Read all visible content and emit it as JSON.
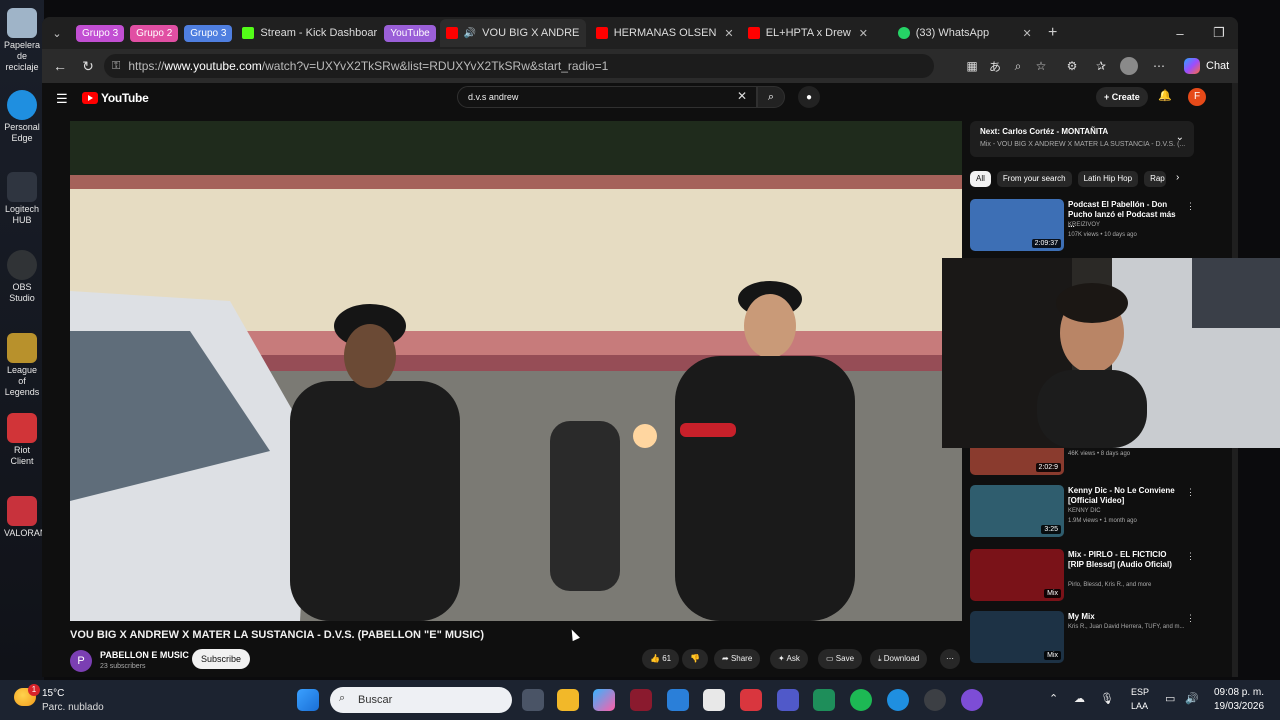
{
  "desktop": {
    "icons": [
      {
        "label": "Papelera de reciclaje",
        "color": "#9fb4c8"
      },
      {
        "label": "Personal Edge",
        "color": "#1f8fe0"
      },
      {
        "label": "Logitech HUB",
        "color": "#2f3540"
      },
      {
        "label": "OBS Studio",
        "color": "#303336"
      },
      {
        "label": "League of Legends",
        "color": "#b8912c"
      },
      {
        "label": "Riot Client",
        "color": "#d13438"
      },
      {
        "label": "VALORANT",
        "color": "#c8323c"
      }
    ]
  },
  "browser": {
    "tab_groups": [
      {
        "label": "Grupo 3",
        "color": "#c24fd3"
      },
      {
        "label": "Grupo 2",
        "color": "#e14fa3"
      },
      {
        "label": "Grupo 3",
        "color": "#4f7fe0"
      }
    ],
    "tabs": [
      {
        "title": "Stream - Kick Dashboar",
        "fav": "#53fc18",
        "active": false
      },
      {
        "group": "YouTube",
        "group_color": "#9a5fd8"
      },
      {
        "title": "VOU BIG X ANDRE",
        "fav": "#ff0000",
        "active": true
      },
      {
        "title": "HERMANAS OLSEN",
        "fav": "#ff0000",
        "active": false
      },
      {
        "title": "EL+HPTA x Drew",
        "fav": "#ff0000",
        "active": false
      },
      {
        "title": "(33) WhatsApp",
        "fav": "#25d366",
        "active": false
      }
    ],
    "url_prefix": "https://",
    "url_host": "www.youtube.com",
    "url_path": "/watch?v=UXYvX2TkSRw&list=RDUXYvX2TkSRw&start_radio=1",
    "chat_label": "Chat"
  },
  "youtube": {
    "logo": "YouTube",
    "search_query": "d.v.s andrew",
    "create_label": "Create",
    "avatar_letter": "F",
    "video_title": "VOU BIG X ANDREW X MATER LA SUSTANCIA - D.V.S. (PABELLON \"E\" MUSIC)",
    "channel_letter": "P",
    "channel_name": "PABELLON E MUSIC",
    "channel_subs": "23 subscribers",
    "subscribe_label": "Subscribe",
    "likes": "61",
    "share_label": "Share",
    "ask_label": "Ask",
    "save_label": "Save",
    "download_label": "Download",
    "next_title": "Next: Carlos Cortéz - MONTAÑITA",
    "next_sub": "Mix - VOU BIG X ANDREW X MATER LA SUSTANCIA - D.V.S. (...",
    "chips": [
      "All",
      "From your search",
      "Latin Hip Hop",
      "Rap"
    ],
    "recs": [
      {
        "title": "Podcast El Pabellón - Don Pucho lanzó el Podcast más ...",
        "channel": "KREIZIVOY",
        "meta": "107K views • 10 days ago",
        "dur": "2:09:37",
        "thumb": "#3d6fb5"
      },
      {
        "title": "",
        "channel": "",
        "meta": "46K views • 8 days ago",
        "dur": "2:02:9",
        "thumb": "#8a3b2e"
      },
      {
        "title": "Kenny Dic - No Le Conviene [Official Video]",
        "channel": "KENNY DIC",
        "meta": "1.9M views • 1 month ago",
        "dur": "3:25",
        "thumb": "#2f5d6e"
      },
      {
        "title": "Mix - PIRLO - EL FICTICIO [RIP Blessd] (Audio Oficial)",
        "channel": "Pirlo, Blessd, Kris R., and more",
        "meta": "",
        "dur": "Mix",
        "thumb": "#7a1218"
      },
      {
        "title": "My Mix",
        "channel": "Kris R., Juan David Herrera, TUFY, and m...",
        "meta": "",
        "dur": "Mix",
        "thumb": "#1d3245"
      }
    ]
  },
  "taskbar": {
    "weather_badge": "1",
    "temperature": "15°C",
    "condition": "Parc. nublado",
    "search_placeholder": "Buscar",
    "lang_top": "ESP",
    "lang_bottom": "LAA",
    "time": "09:08 p. m.",
    "date": "19/03/2026"
  }
}
